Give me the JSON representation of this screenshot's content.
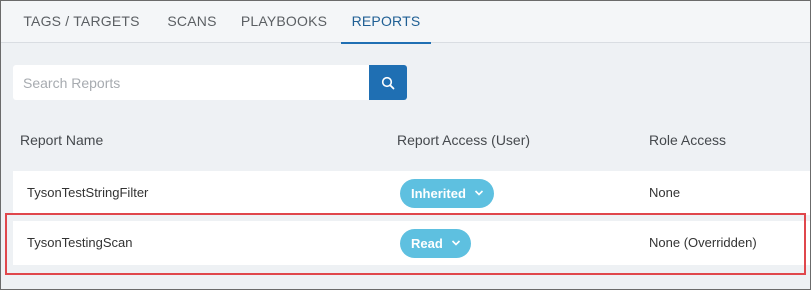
{
  "tabs": [
    {
      "label": "TAGS / TARGETS",
      "active": false
    },
    {
      "label": "SCANS",
      "active": false
    },
    {
      "label": "PLAYBOOKS",
      "active": false
    },
    {
      "label": "REPORTS",
      "active": true
    }
  ],
  "search": {
    "placeholder": "Search Reports",
    "value": "",
    "icon": "search-icon"
  },
  "table": {
    "columns": [
      "Report Name",
      "Report Access (User)",
      "Role Access"
    ],
    "rows": [
      {
        "name": "TysonTestStringFilter",
        "access": "Inherited",
        "role_access": "None"
      },
      {
        "name": "TysonTestingScan",
        "access": "Read",
        "role_access": "None (Overridden)"
      }
    ]
  },
  "colors": {
    "accent": "#1f6fb3",
    "pill": "#5ec0e0",
    "highlight": "#e0474c",
    "background": "#eef1f4"
  }
}
